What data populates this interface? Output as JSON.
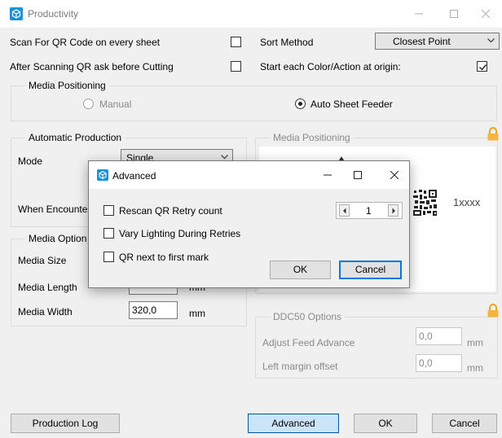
{
  "window": {
    "title": "Productivity"
  },
  "options": {
    "scan_qr_label": "Scan For QR Code on every sheet",
    "scan_qr_checked": false,
    "ask_before_cutting_label": "After Scanning QR ask before Cutting",
    "ask_before_cutting_checked": false,
    "sort_method_label": "Sort Method",
    "sort_method_value": "Closest Point",
    "start_at_origin_label": "Start each Color/Action at origin:",
    "start_at_origin_checked": true
  },
  "media_positioning_top": {
    "title": "Media Positioning",
    "manual_label": "Manual",
    "auto_feeder_label": "Auto Sheet Feeder",
    "selected": "Auto Sheet Feeder"
  },
  "automatic_production": {
    "title": "Automatic Production",
    "mode_label": "Mode",
    "mode_value": "Single",
    "when_encountering_label": "When Encounteri"
  },
  "media_options": {
    "title": "Media Option",
    "media_size_label": "Media Size",
    "media_length_label": "Media Length",
    "media_length_unit": "mm",
    "media_width_label": "Media Width",
    "media_width_value": "320,0",
    "media_width_unit": "mm"
  },
  "media_positioning_preview": {
    "title": "Media Positioning",
    "sheet_label": "1xxxx"
  },
  "ddc50": {
    "title": "DDC50 Options",
    "feed_advance_label": "Adjust Feed Advance",
    "feed_advance_value": "0,0",
    "feed_advance_unit": "mm",
    "left_margin_label": "Left margin offset",
    "left_margin_value": "0,0",
    "left_margin_unit": "mm"
  },
  "buttons": {
    "production_log": "Production Log",
    "advanced": "Advanced",
    "ok": "OK",
    "cancel": "Cancel"
  },
  "advanced_dialog": {
    "title": "Advanced",
    "rescan_label": "Rescan QR Retry count",
    "rescan_checked": false,
    "retry_count": "1",
    "vary_lighting_label": "Vary Lighting During Retries",
    "vary_lighting_checked": false,
    "qr_next_label": "QR next to first mark",
    "qr_next_checked": false,
    "ok": "OK",
    "cancel": "Cancel"
  },
  "icons": {
    "app": "cube-icon",
    "lock": "padlock-icon"
  },
  "colors": {
    "accent": "#0078d7",
    "app_icon": "#1e90d6",
    "lock": "#f0a020"
  }
}
